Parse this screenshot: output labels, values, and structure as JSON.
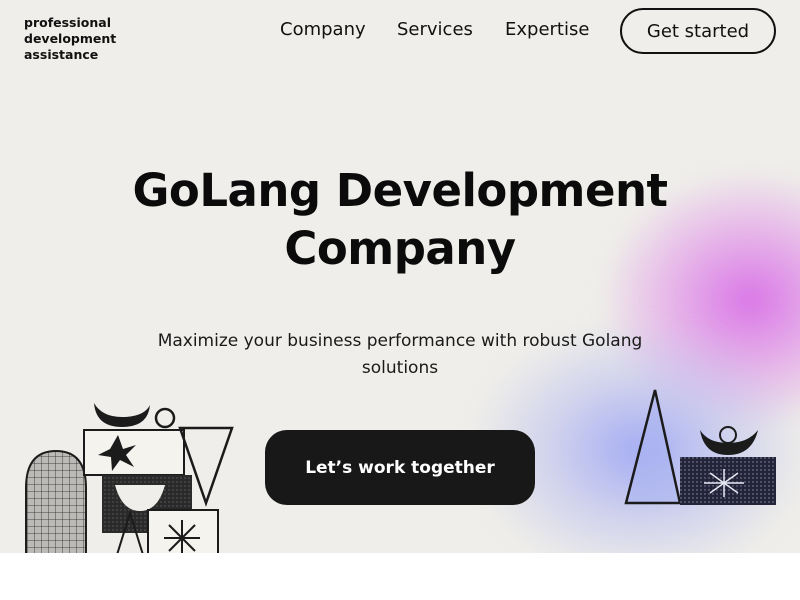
{
  "brand": {
    "lines": [
      "professional",
      "development",
      "assistance"
    ]
  },
  "nav": {
    "items": [
      "Company",
      "Services",
      "Expertise"
    ],
    "cta_label": "Get started"
  },
  "hero": {
    "title_line1": "GoLang Development",
    "title_line2": "Company",
    "subtitle_line1": "Maximize your business performance with robust Golang",
    "subtitle_line2": "solutions",
    "cta_label": "Let’s work together"
  },
  "colors": {
    "hero_background": "#efeeea",
    "button_dark": "#181818",
    "accent_pink": "#d870e6",
    "accent_blue": "#96a0f5"
  },
  "icons": [
    "abstract-shapes-left-illustration",
    "abstract-shapes-right-illustration"
  ]
}
